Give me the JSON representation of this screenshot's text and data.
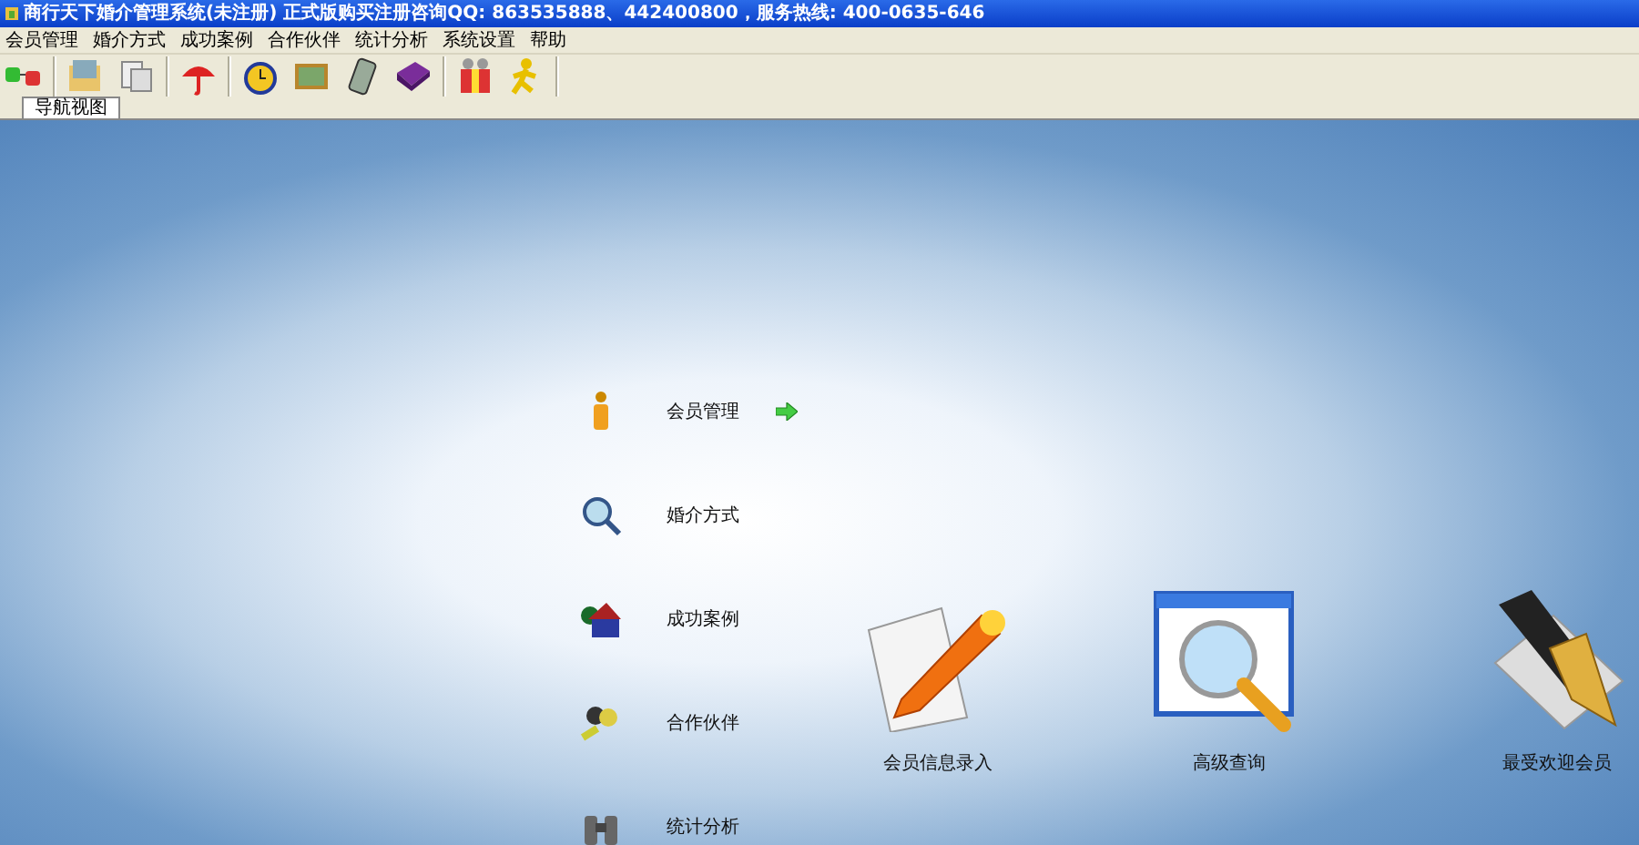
{
  "window": {
    "title": "商行天下婚介管理系统(未注册) 正式版购买注册咨询QQ: 863535888、442400800，服务热线: 400-0635-646"
  },
  "menu": [
    "会员管理",
    "婚介方式",
    "成功案例",
    "合作伙伴",
    "统计分析",
    "系统设置",
    "帮助"
  ],
  "tabs": [
    {
      "label": "导航视图",
      "selected": true
    }
  ],
  "nav": [
    {
      "label": "会员管理",
      "kind": "member",
      "selected": true
    },
    {
      "label": "婚介方式",
      "kind": "search",
      "selected": false
    },
    {
      "label": "成功案例",
      "kind": "house",
      "selected": false
    },
    {
      "label": "合作伙伴",
      "kind": "people",
      "selected": false
    },
    {
      "label": "统计分析",
      "kind": "binoculars",
      "selected": false
    }
  ],
  "tiles": [
    {
      "label": "会员信息录入",
      "kind": "pen"
    },
    {
      "label": "高级查询",
      "kind": "magnifier"
    },
    {
      "label": "最受欢迎会员",
      "kind": "fountain-pen"
    }
  ]
}
